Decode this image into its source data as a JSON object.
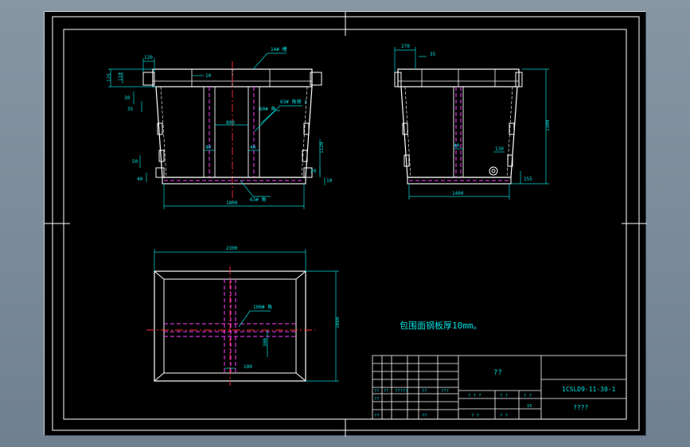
{
  "colors": {
    "background": "#000000",
    "app_chrome": "#7d8e9c",
    "frame_line": "#ffffff",
    "dimension": "#00d8d8",
    "object_line": "#ffffff",
    "hidden_line": "#ff40ff",
    "center_line": "#ff3030",
    "leader": "#00d8d8"
  },
  "front_view": {
    "dims": {
      "top_w1": "120",
      "top_h1": "125",
      "top_h2": "110",
      "top_h3": "30",
      "top_h4": "35",
      "left_lip1": "50",
      "left_lip2": "40",
      "mid_gap": "10",
      "center_w": "800",
      "post_w_left": "40",
      "post_w_right": "40",
      "right_h1": "1120",
      "right_h2": "20",
      "right_h3": "10",
      "base_w": "1800"
    },
    "callouts": {
      "top_beam": "14# 槽",
      "right_upper": "63# 角钢 1",
      "post": "60# 角",
      "base": "63# 角"
    }
  },
  "side_view": {
    "dims": {
      "top_w": "270",
      "top_w2": "35",
      "height": "1300",
      "post_w": "40",
      "right_w": "130",
      "base_h": "155",
      "base_w": "1400"
    }
  },
  "plan_view": {
    "dims": {
      "width": "2300",
      "height": "1660",
      "callout": "100# 角",
      "mid_dim": "300",
      "bottom_dim": "100"
    }
  },
  "note": "包围面钢板厚10mm。",
  "title_block": {
    "drawing_no": "1CSLD9-11-30-1",
    "part_name": "??",
    "part_subtitle": "????",
    "left_cells": [
      "??",
      "??",
      "?????",
      "??",
      "???",
      "??",
      "??",
      "??"
    ],
    "mid_cells": [
      "? ? ?",
      "? ?",
      "? ?",
      "15",
      "? ?",
      "? ?"
    ]
  }
}
